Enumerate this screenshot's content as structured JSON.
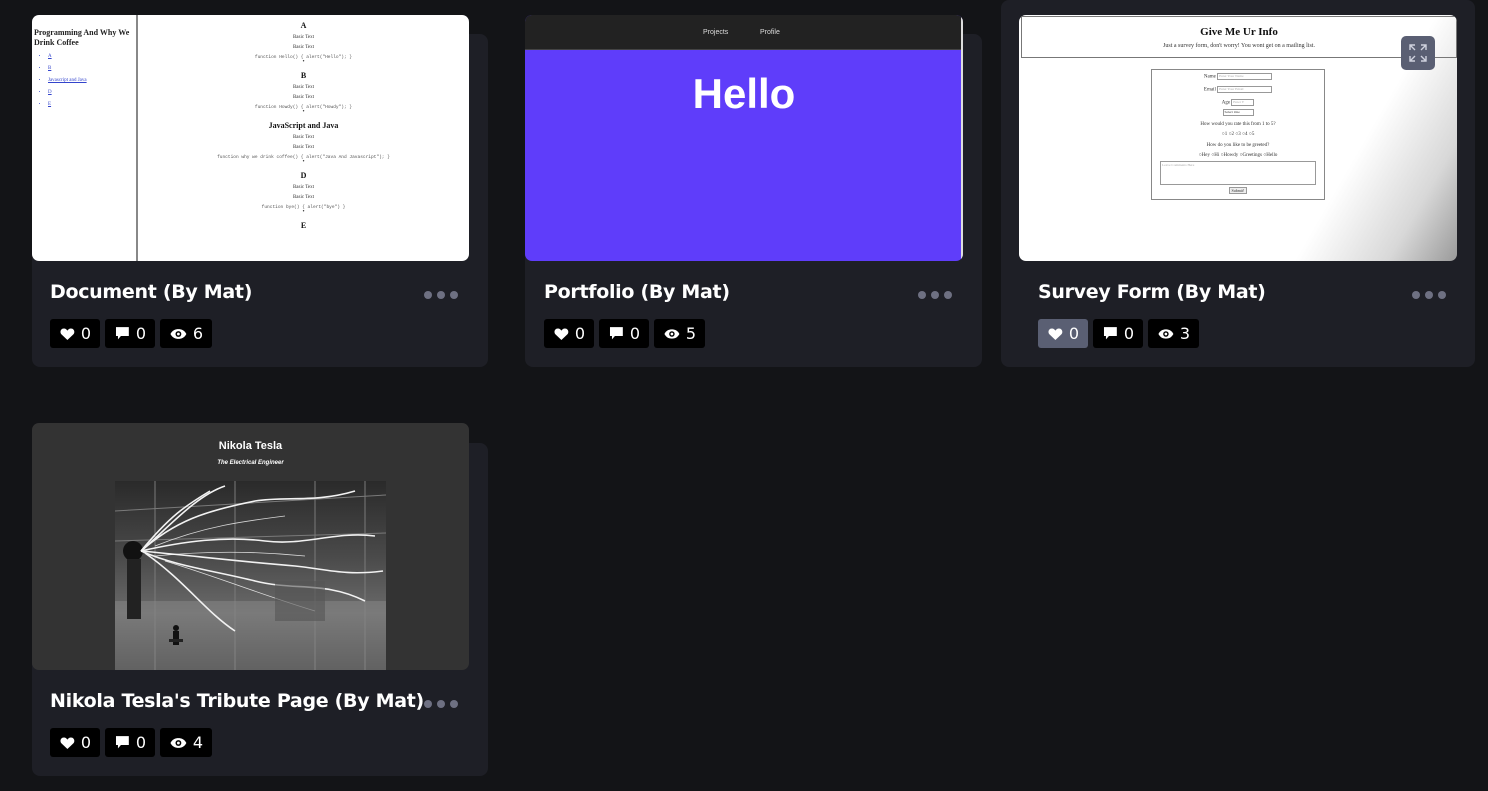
{
  "cards": [
    {
      "title": "Document (By Mat)",
      "likes": "0",
      "comments": "0",
      "views": "6",
      "preview": {
        "sidebar_title": "Programming And Why We Drink Coffee",
        "links": [
          "A",
          "B",
          "Javascript and Java",
          "D",
          "E"
        ],
        "sections": [
          {
            "heading": "A",
            "text1": "Basic Text",
            "text2": "Basic Text",
            "code": "function Hello() { alert(\"Hello\"); }"
          },
          {
            "heading": "B",
            "text1": "Basic Text",
            "text2": "Basic Text",
            "code": "function Howdy() { alert(\"Howdy\"); }"
          },
          {
            "heading": "JavaScript and Java",
            "text1": "Basic Text",
            "text2": "Basic Text",
            "code": "function why we drink coffee() { alert(\"Java And Javascript\"); }"
          },
          {
            "heading": "D",
            "text1": "Basic Text",
            "text2": "Basic Text",
            "code": "function bye() { alert(\"bye\") }"
          }
        ],
        "partial_heading": "E"
      }
    },
    {
      "title": "Portfolio (By Mat)",
      "likes": "0",
      "comments": "0",
      "views": "5",
      "preview": {
        "nav": [
          "Projects",
          "Profile"
        ],
        "hero": "Hello",
        "hero_color": "#5f3dfa"
      }
    },
    {
      "title": "Survey Form (By Mat)",
      "likes": "0",
      "comments": "0",
      "views": "3",
      "like_active": true,
      "preview": {
        "heading": "Give Me Ur Info",
        "subheading": "Just a survey form, don't worry! You wont get on a mailing list.",
        "name_label": "Name",
        "name_placeholder": "Enter Your Name",
        "email_label": "Email",
        "email_placeholder": "Enter Your Email",
        "age_label": "Age",
        "age_placeholder": "Enter Y",
        "select_value": "Select One",
        "rate_question": "How would you rate this from 1 to 5?",
        "rate_options": [
          "1",
          "2",
          "3",
          "4",
          "5"
        ],
        "greet_question": "How do you like to be greeted?",
        "greet_options": [
          "Hey",
          "Hi",
          "Howdy",
          "Greetings",
          "Hello"
        ],
        "comment_placeholder": "Leave Comments Here",
        "submit": "Submit!"
      }
    },
    {
      "title": "Nikola Tesla's Tribute Page (By Mat)",
      "likes": "0",
      "comments": "0",
      "views": "4",
      "preview": {
        "heading": "Nikola Tesla",
        "subheading": "The Electrical Engineer"
      }
    }
  ],
  "icons": {
    "like": "heart-icon",
    "comment": "comment-icon",
    "view": "eye-icon",
    "more": "more-dots-icon",
    "expand": "expand-icon"
  },
  "colors": {
    "page_bg": "#131417",
    "card_bg": "#1e1f26",
    "stat_bg": "#000000",
    "stat_active_bg": "#5a5f73",
    "dots": "#6e7082"
  }
}
